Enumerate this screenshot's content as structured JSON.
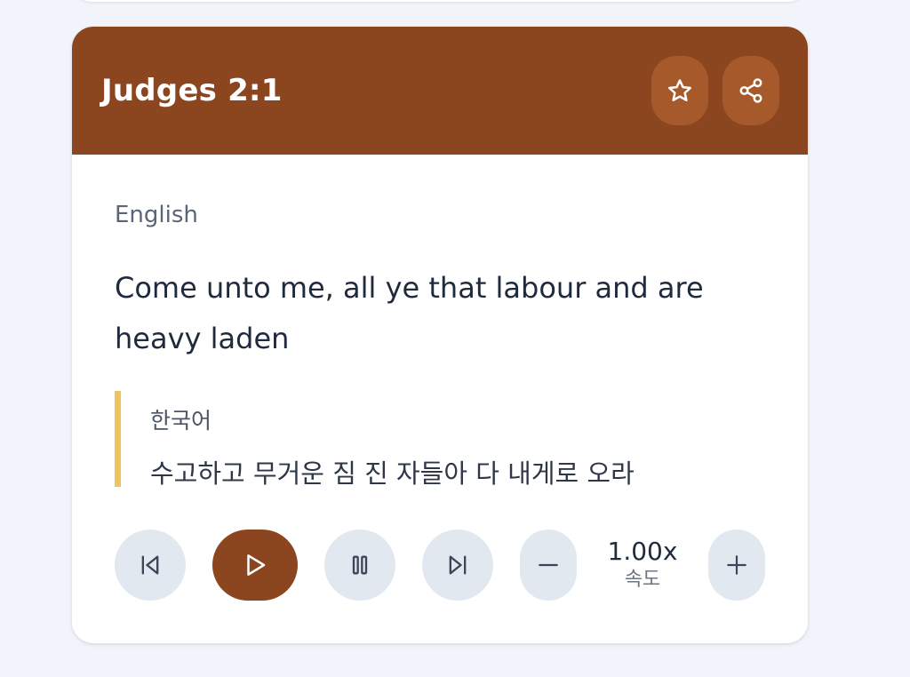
{
  "card": {
    "title": "Judges 2:1",
    "primary_language": "English",
    "verse_text": "Come unto me, all ye that labour and are heavy laden",
    "translation": {
      "language": "한국어",
      "text": "수고하고 무거운 짐 진 자들아 다 내게로 오라"
    }
  },
  "controls": {
    "speed_value": "1.00x",
    "speed_label": "속도"
  },
  "icons": {
    "header": [
      "star-icon",
      "share-icon"
    ],
    "playback": [
      "skip-back-icon",
      "play-icon",
      "pause-icon",
      "skip-forward-icon",
      "minus-icon",
      "plus-icon"
    ]
  },
  "colors": {
    "header_bg": "#8b451f",
    "header_button_bg": "#a65a2b",
    "translation_accent": "#efc45a",
    "control_bg": "#e2e8f0"
  }
}
